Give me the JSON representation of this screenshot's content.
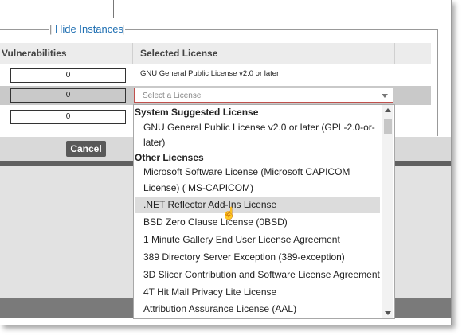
{
  "fieldset": {
    "legend_link": "Hide Instances"
  },
  "table": {
    "headers": [
      "Vulnerabilities",
      "Selected License"
    ],
    "rows": [
      {
        "vulnerabilities": "0",
        "license": "GNU General Public License v2.0 or later"
      },
      {
        "vulnerabilities": "0",
        "license_placeholder": "Select a License"
      },
      {
        "vulnerabilities": "0"
      }
    ]
  },
  "buttons": {
    "cancel": "Cancel"
  },
  "dropdown": {
    "group1": "System Suggested License",
    "group1_items": [
      "GNU General Public License v2.0 or later (GPL-2.0-or-",
      "later)"
    ],
    "group2": "Other Licenses",
    "items": [
      "Microsoft Software License (Microsoft CAPICOM",
      "License) ( MS-CAPICOM)",
      ".NET Reflector Add-Ins License",
      "BSD Zero Clause License (0BSD)",
      "1 Minute Gallery End User License Agreement",
      "389 Directory Server Exception (389-exception)",
      "3D Slicer Contribution and Software License Agreement",
      "4T Hit Mail Privacy Lite License",
      "Attribution Assurance License (AAL)"
    ],
    "highlighted_index": 2
  },
  "colors": {
    "link": "#1f6fb2",
    "button": "#595959",
    "error_border": "#c0504d"
  }
}
